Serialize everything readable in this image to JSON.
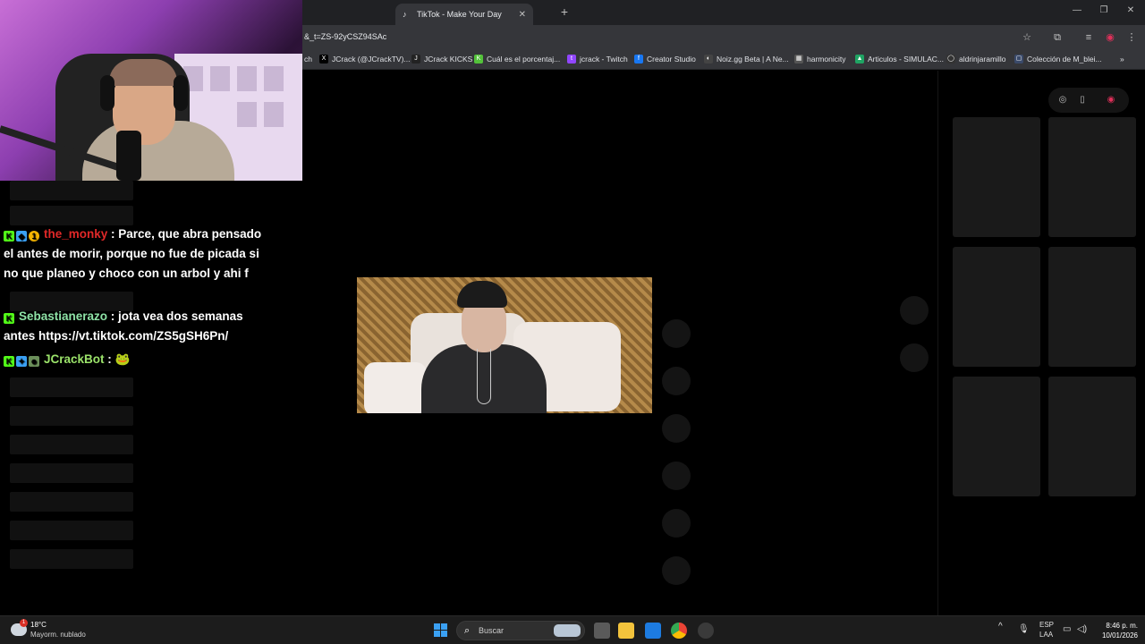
{
  "browser": {
    "tab_title": "TikTok - Make Your Day",
    "url_text": "&_t=ZS-92yCSZ94SAc",
    "bookmarks": [
      {
        "label": "ch"
      },
      {
        "label": "JCrack (@JCrackTV)..."
      },
      {
        "label": "JCrack KICKS"
      },
      {
        "label": "Cuál es el porcentaj..."
      },
      {
        "label": "jcrack - Twitch"
      },
      {
        "label": "Creator Studio"
      },
      {
        "label": "Noiz.gg Beta | A Ne..."
      },
      {
        "label": "harmonicity"
      },
      {
        "label": "Articulos - SIMULAC..."
      },
      {
        "label": "aldrinjaramillo"
      },
      {
        "label": "Colección de M_blei..."
      }
    ]
  },
  "chat": {
    "messages": [
      {
        "user": "the_monky",
        "user_color": "#e02828",
        "text": "Parce, que abra pensado el antes de morir, porque no fue de picada si no que planeo y choco con un arbol y ahi f"
      },
      {
        "user": "Sebastianerazo",
        "user_color": "#8ee2a6",
        "text": "jota vea dos semanas antes https://vt.tiktok.com/ZS5gSH6Pn/"
      },
      {
        "user": "JCrackBot",
        "user_color": "#9be36a",
        "text": "🐸"
      }
    ]
  },
  "taskbar": {
    "temperature": "18°C",
    "weather_condition": "Mayorm. nublado",
    "weather_badge": "1",
    "search_placeholder": "Buscar",
    "language": "ESP",
    "keyboard": "LAA",
    "time": "8:46 p. m.",
    "date": "10/01/2026"
  },
  "colors": {
    "accent_chrome": "#35363a",
    "tiktok_bg": "#000000",
    "windows_blue": "#3aa0f3"
  }
}
